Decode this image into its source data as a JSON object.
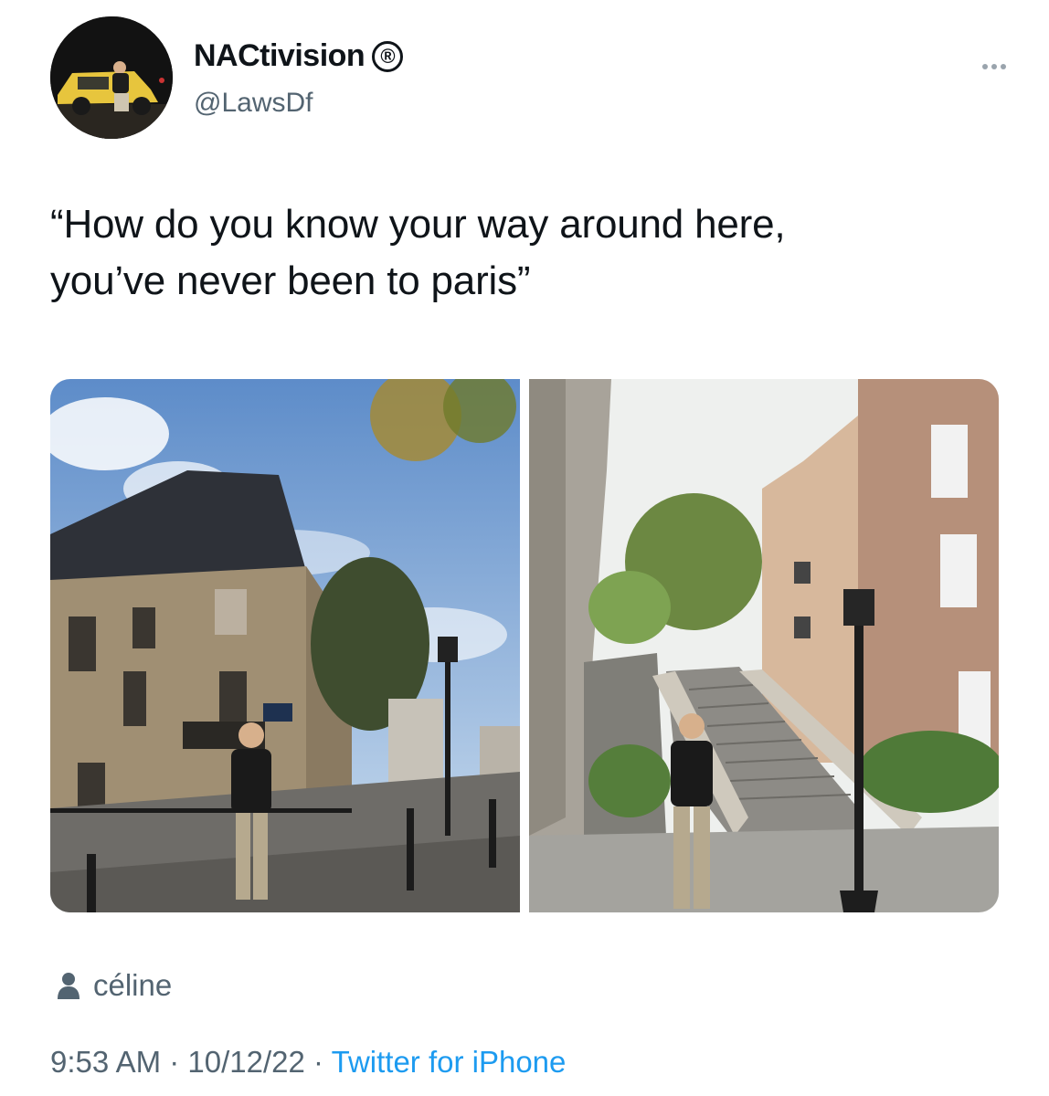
{
  "tweet": {
    "author": {
      "display_name": "NACtivision",
      "verified_badge": "®",
      "handle": "@LawsDf"
    },
    "text": "“How do you know your way around here,\nyou’ve never been to paris”",
    "media_count": 2,
    "tagged_user": "céline",
    "timestamp": {
      "time": "9:53 AM",
      "separator1": " · ",
      "date": "10/12/22",
      "separator2": " · ",
      "source": "Twitter for iPhone"
    }
  },
  "icons": {
    "more": "more-horizontal-icon",
    "person": "person-icon",
    "registered": "registered-icon"
  },
  "colors": {
    "text_primary": "#0f1419",
    "text_secondary": "#536471",
    "link": "#1d9bf0"
  }
}
